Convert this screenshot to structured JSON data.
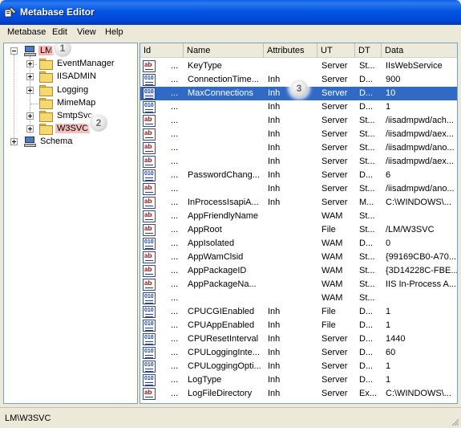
{
  "window": {
    "title": "Metabase Editor"
  },
  "menu": [
    "Metabase",
    "Edit",
    "View",
    "Help"
  ],
  "tree": {
    "root": "LM",
    "children": [
      "EventManager",
      "IISADMIN",
      "Logging",
      "MimeMap",
      "SmtpSvc",
      "W3SVC"
    ],
    "schema": "Schema"
  },
  "callouts": [
    "1",
    "2",
    "3"
  ],
  "list": {
    "columns": [
      "Id",
      "Name",
      "Attributes",
      "UT",
      "DT",
      "Data"
    ],
    "rows": [
      {
        "icon": "string-icon",
        "id": "...",
        "name": "KeyType",
        "attr": "",
        "ut": "Server",
        "dt": "St...",
        "data": "IIsWebService"
      },
      {
        "icon": "number-icon",
        "id": "...",
        "name": "ConnectionTime...",
        "attr": "Inh",
        "ut": "Server",
        "dt": "D...",
        "data": "900"
      },
      {
        "icon": "number-icon",
        "id": "...",
        "name": "MaxConnections",
        "attr": "Inh",
        "ut": "Server",
        "dt": "D...",
        "data": "10"
      },
      {
        "icon": "number-icon",
        "id": "...",
        "name": "",
        "attr": "Inh",
        "ut": "Server",
        "dt": "D...",
        "data": "1"
      },
      {
        "icon": "string-icon",
        "id": "...",
        "name": "",
        "attr": "Inh",
        "ut": "Server",
        "dt": "St...",
        "data": "/iisadmpwd/ach..."
      },
      {
        "icon": "string-icon",
        "id": "...",
        "name": "",
        "attr": "Inh",
        "ut": "Server",
        "dt": "St...",
        "data": "/iisadmpwd/aex..."
      },
      {
        "icon": "string-icon",
        "id": "...",
        "name": "",
        "attr": "Inh",
        "ut": "Server",
        "dt": "St...",
        "data": "/iisadmpwd/ano..."
      },
      {
        "icon": "string-icon",
        "id": "...",
        "name": "",
        "attr": "Inh",
        "ut": "Server",
        "dt": "St...",
        "data": "/iisadmpwd/aex..."
      },
      {
        "icon": "number-icon",
        "id": "...",
        "name": "PasswordChang...",
        "attr": "Inh",
        "ut": "Server",
        "dt": "D...",
        "data": "6"
      },
      {
        "icon": "string-icon",
        "id": "...",
        "name": "",
        "attr": "Inh",
        "ut": "Server",
        "dt": "St...",
        "data": "/iisadmpwd/ano..."
      },
      {
        "icon": "string-icon",
        "id": "...",
        "name": "InProcessIsapiA...",
        "attr": "Inh",
        "ut": "Server",
        "dt": "M...",
        "data": "C:\\WINDOWS\\..."
      },
      {
        "icon": "string-icon",
        "id": "...",
        "name": "AppFriendlyName",
        "attr": "",
        "ut": "WAM",
        "dt": "St...",
        "data": ""
      },
      {
        "icon": "string-icon",
        "id": "...",
        "name": "AppRoot",
        "attr": "",
        "ut": "File",
        "dt": "St...",
        "data": "/LM/W3SVC"
      },
      {
        "icon": "number-icon",
        "id": "...",
        "name": "AppIsolated",
        "attr": "",
        "ut": "WAM",
        "dt": "D...",
        "data": "0"
      },
      {
        "icon": "string-icon",
        "id": "...",
        "name": "AppWamClsid",
        "attr": "",
        "ut": "WAM",
        "dt": "St...",
        "data": "{99169CB0-A70..."
      },
      {
        "icon": "string-icon",
        "id": "...",
        "name": "AppPackageID",
        "attr": "",
        "ut": "WAM",
        "dt": "St...",
        "data": "{3D14228C-FBE..."
      },
      {
        "icon": "string-icon",
        "id": "...",
        "name": "AppPackageNa...",
        "attr": "",
        "ut": "WAM",
        "dt": "St...",
        "data": "IIS In-Process A..."
      },
      {
        "icon": "number-icon",
        "id": "...",
        "name": "",
        "attr": "",
        "ut": "WAM",
        "dt": "St...",
        "data": ""
      },
      {
        "icon": "number-icon",
        "id": "...",
        "name": "CPUCGIEnabled",
        "attr": "Inh",
        "ut": "File",
        "dt": "D...",
        "data": "1"
      },
      {
        "icon": "number-icon",
        "id": "...",
        "name": "CPUAppEnabled",
        "attr": "Inh",
        "ut": "File",
        "dt": "D...",
        "data": "1"
      },
      {
        "icon": "number-icon",
        "id": "...",
        "name": "CPUResetInterval",
        "attr": "Inh",
        "ut": "Server",
        "dt": "D...",
        "data": "1440"
      },
      {
        "icon": "number-icon",
        "id": "...",
        "name": "CPULoggingInte...",
        "attr": "Inh",
        "ut": "Server",
        "dt": "D...",
        "data": "60"
      },
      {
        "icon": "number-icon",
        "id": "...",
        "name": "CPULoggingOpti...",
        "attr": "Inh",
        "ut": "Server",
        "dt": "D...",
        "data": "1"
      },
      {
        "icon": "number-icon",
        "id": "...",
        "name": "LogType",
        "attr": "Inh",
        "ut": "Server",
        "dt": "D...",
        "data": "1"
      },
      {
        "icon": "string-icon",
        "id": "...",
        "name": "LogFileDirectory",
        "attr": "Inh",
        "ut": "Server",
        "dt": "Ex...",
        "data": "C:\\WINDOWS\\..."
      }
    ],
    "selected_index": 2
  },
  "status": {
    "path": "LM\\W3SVC"
  },
  "colors": {
    "title_bar": "#0355e1",
    "selection": "#316ac5",
    "highlight": "#f8b3b3"
  }
}
